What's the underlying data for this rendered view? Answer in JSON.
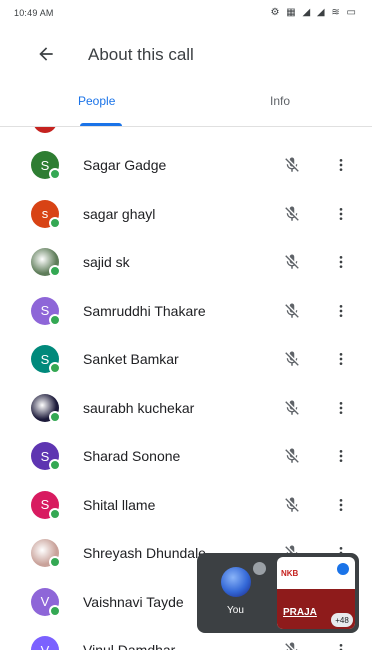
{
  "status_bar": {
    "time": "10:49 AM",
    "icons_text": "⚙ ▦ ◢ ◢ ≋ ▭"
  },
  "header": {
    "back_icon": "arrow-back-icon",
    "title": "About this call"
  },
  "tabs": [
    {
      "label": "People",
      "active": true
    },
    {
      "label": "Info",
      "active": false
    }
  ],
  "colors": {
    "accent": "#1a73e8",
    "online_dot": "#34a853"
  },
  "participants": [
    {
      "name": "Sagar Gadge",
      "initial": "S",
      "avatar_color": "#2e7d32",
      "avatar_type": "letter",
      "muted": true
    },
    {
      "name": "sagar ghayl",
      "initial": "s",
      "avatar_color": "#d84315",
      "avatar_type": "letter",
      "muted": true
    },
    {
      "name": "sajid sk",
      "initial": "",
      "avatar_color": "#5f7d5a",
      "avatar_type": "photo",
      "muted": true
    },
    {
      "name": "Samruddhi Thakare",
      "initial": "S",
      "avatar_color": "#8e66d8",
      "avatar_type": "letter",
      "muted": true
    },
    {
      "name": "Sanket Bamkar",
      "initial": "S",
      "avatar_color": "#00897b",
      "avatar_type": "letter",
      "muted": true
    },
    {
      "name": "saurabh kuchekar",
      "initial": "",
      "avatar_color": "#1c1a3a",
      "avatar_type": "photo",
      "muted": true
    },
    {
      "name": "Sharad Sonone",
      "initial": "S",
      "avatar_color": "#5e35b1",
      "avatar_type": "letter",
      "muted": true
    },
    {
      "name": "Shital llame",
      "initial": "S",
      "avatar_color": "#d81b60",
      "avatar_type": "letter",
      "muted": true
    },
    {
      "name": "Shreyash Dhundale",
      "initial": "",
      "avatar_color": "#c9a29a",
      "avatar_type": "photo",
      "muted": true
    },
    {
      "name": "Vaishnavi Taydе",
      "initial": "V",
      "avatar_color": "#8e66d8",
      "avatar_type": "letter",
      "muted": false
    },
    {
      "name": "Vinul Damdhar",
      "initial": "V",
      "avatar_color": "#7b61ff",
      "avatar_type": "letter",
      "muted": true
    }
  ],
  "pip": {
    "you_label": "You",
    "badge_text": "",
    "screen_banner_text": "NKB",
    "screen_brand_text": "PRAJA",
    "extra_count": "+48"
  }
}
